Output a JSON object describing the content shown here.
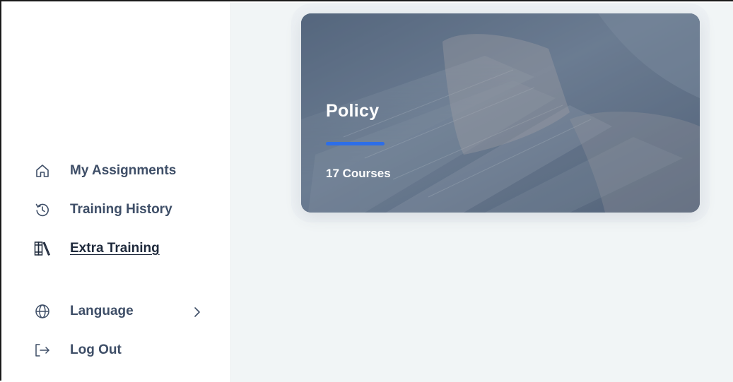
{
  "sidebar": {
    "items": [
      {
        "label": "My Assignments",
        "icon": "home-icon",
        "active": false
      },
      {
        "label": "Training History",
        "icon": "history-icon",
        "active": false
      },
      {
        "label": "Extra Training",
        "icon": "books-icon",
        "active": true
      }
    ],
    "language_label": "Language",
    "language_chevron": "chevron-right-icon",
    "logout_label": "Log Out"
  },
  "main": {
    "card": {
      "title": "Policy",
      "subtitle": "17 Courses",
      "accent": "#2d6ee8"
    }
  },
  "colors": {
    "nav_text": "#3e4e67",
    "main_background": "#f1f5f6"
  }
}
